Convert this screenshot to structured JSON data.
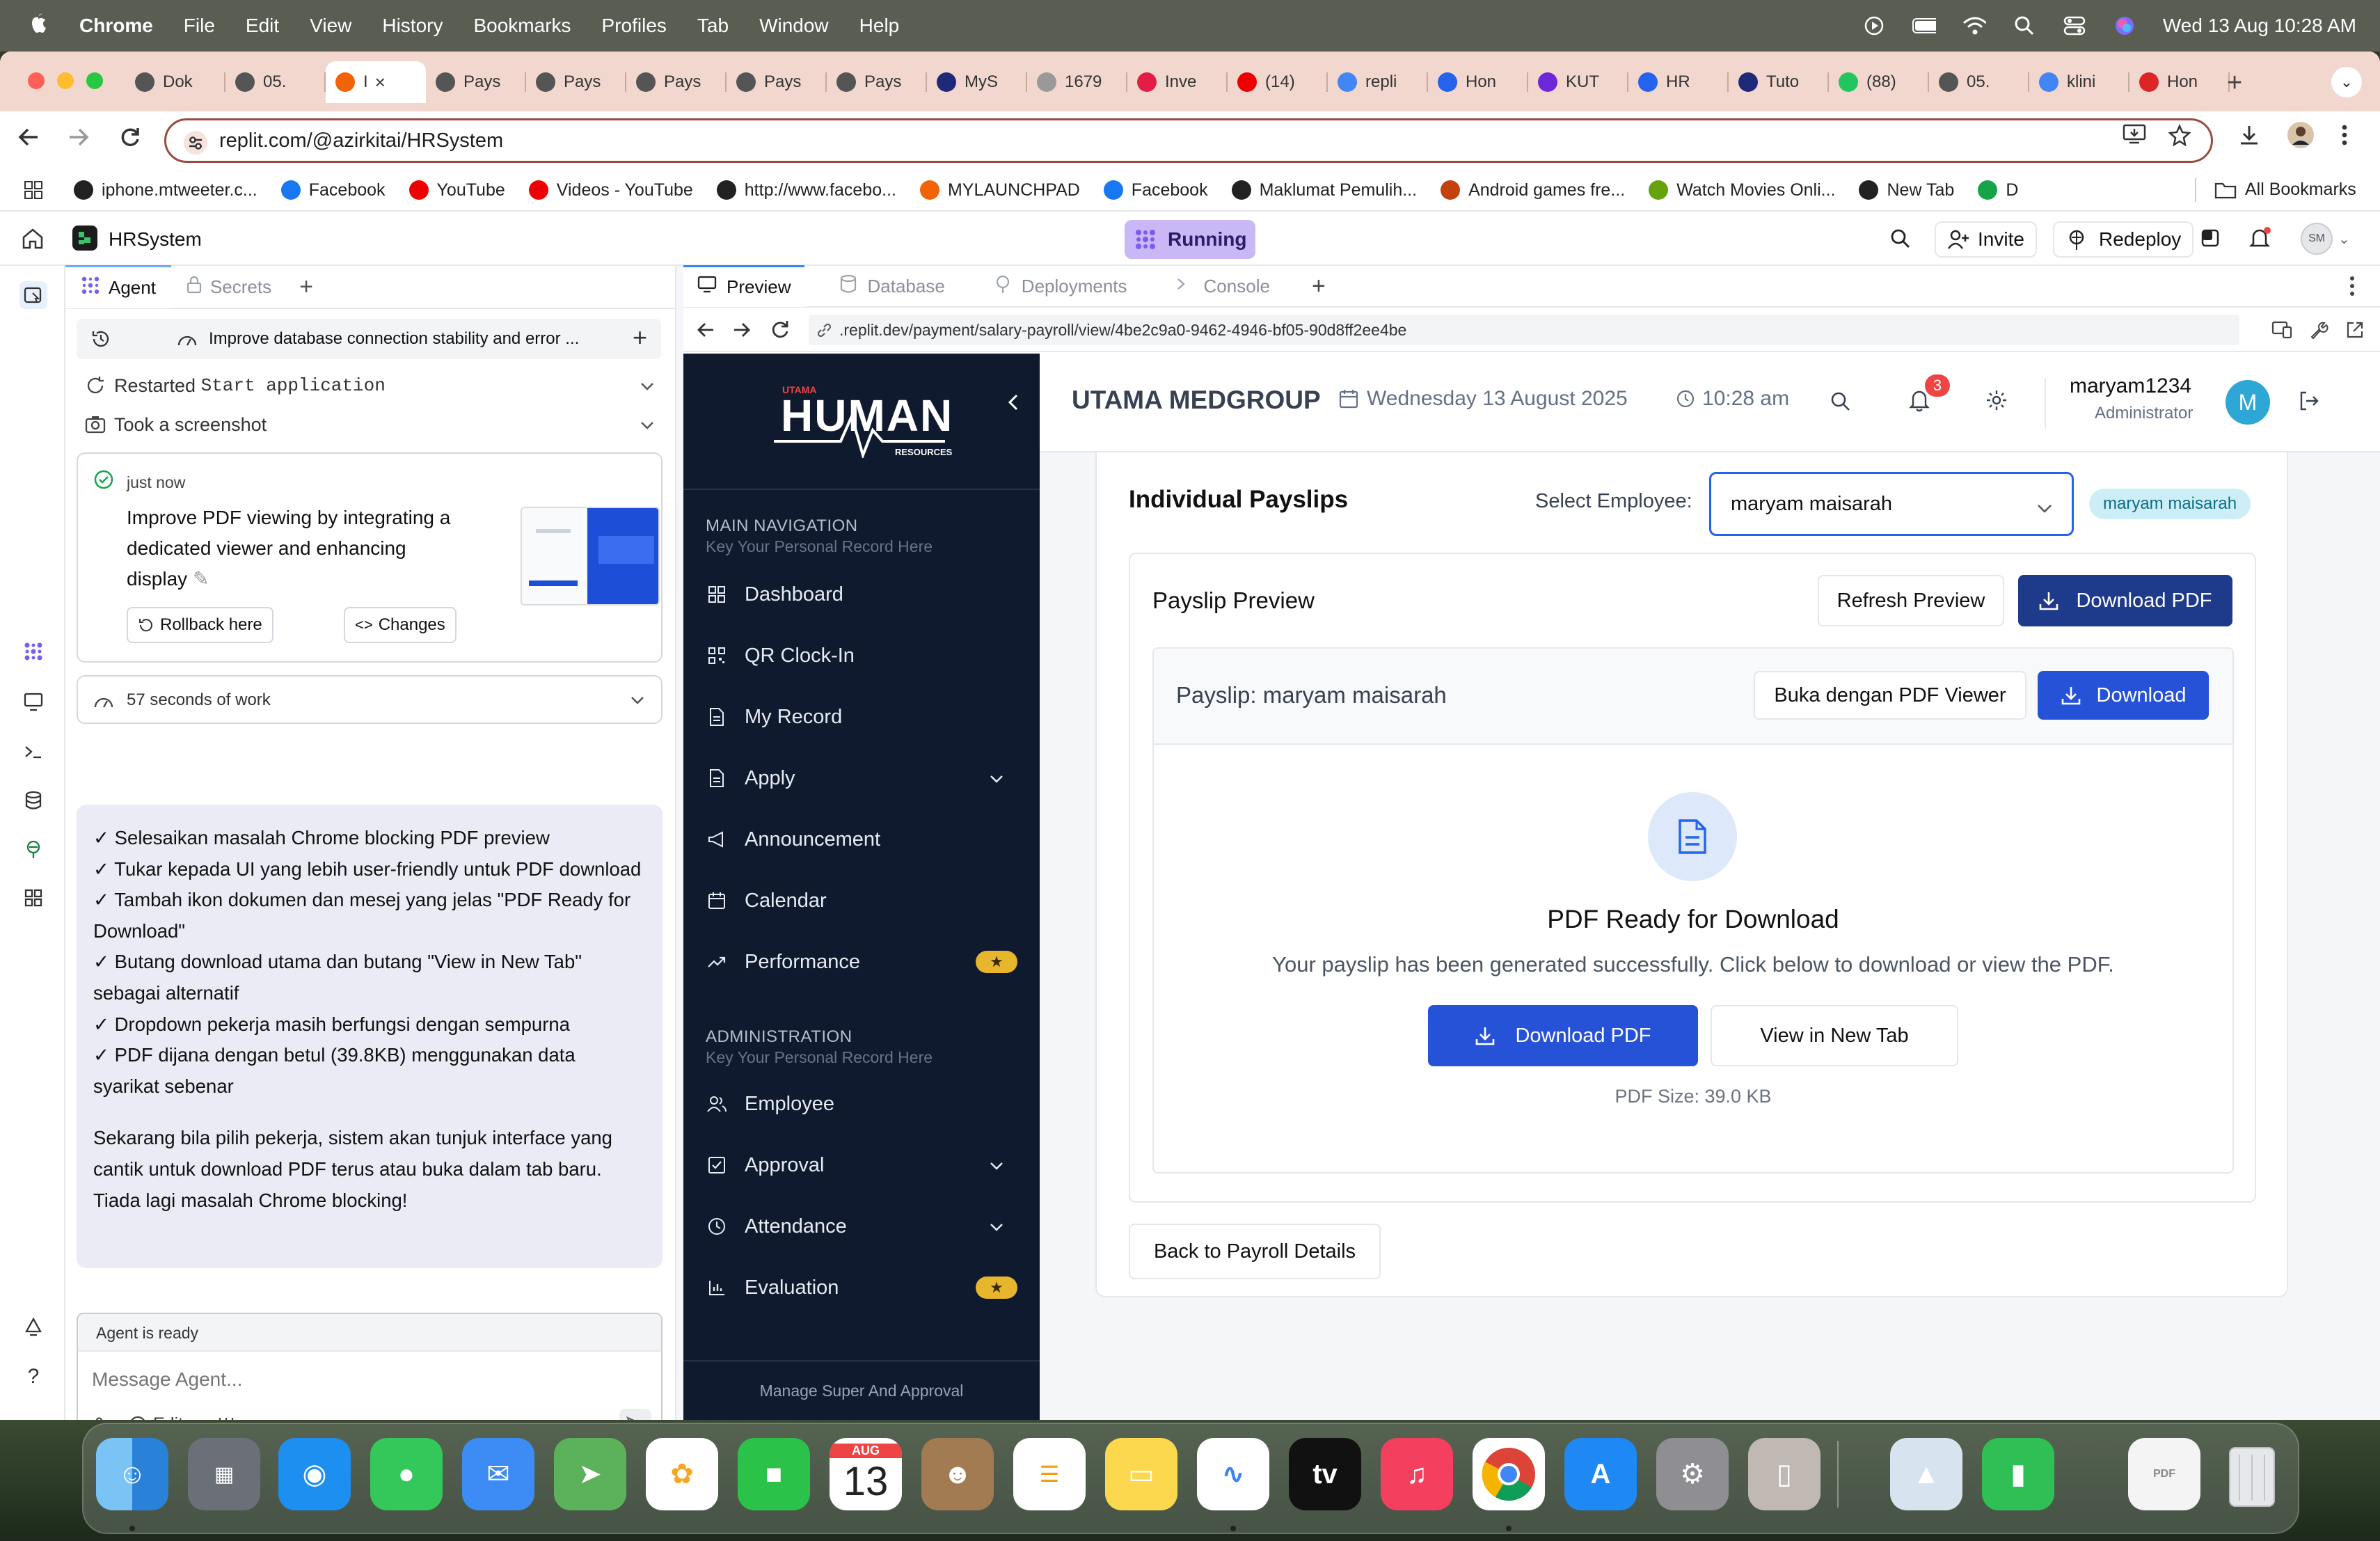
{
  "menubar": {
    "app": "Chrome",
    "items": [
      "File",
      "Edit",
      "View",
      "History",
      "Bookmarks",
      "Profiles",
      "Tab",
      "Window",
      "Help"
    ],
    "datetime": "Wed 13 Aug  10:28 AM"
  },
  "browser": {
    "tabs": [
      {
        "title": "Dok",
        "color": "#555"
      },
      {
        "title": "05.",
        "color": "#555"
      },
      {
        "title": "I",
        "color": "#f26207",
        "active": true
      },
      {
        "title": "Pays",
        "color": "#555"
      },
      {
        "title": "Pays",
        "color": "#555"
      },
      {
        "title": "Pays",
        "color": "#555"
      },
      {
        "title": "Pays",
        "color": "#555"
      },
      {
        "title": "Pays",
        "color": "#555"
      },
      {
        "title": "MyS",
        "color": "#1e2a78"
      },
      {
        "title": "1679",
        "color": "#999"
      },
      {
        "title": "Inve",
        "color": "#e11d48"
      },
      {
        "title": "(14)",
        "color": "#e00"
      },
      {
        "title": "repli",
        "color": "#4285f4"
      },
      {
        "title": "Hon",
        "color": "#2563eb"
      },
      {
        "title": "KUT",
        "color": "#6d28d9"
      },
      {
        "title": "HR",
        "color": "#2563eb"
      },
      {
        "title": "Tuto",
        "color": "#1e2a78"
      },
      {
        "title": "(88)",
        "color": "#22c55e"
      },
      {
        "title": "05.",
        "color": "#555"
      },
      {
        "title": "klini",
        "color": "#4285f4"
      },
      {
        "title": "Hon",
        "color": "#dc2626"
      }
    ],
    "url": "replit.com/@azirkitai/HRSystem",
    "bookmarks": [
      {
        "label": "iphone.mtweeter.c...",
        "color": "#222"
      },
      {
        "label": "Facebook",
        "color": "#1877f2"
      },
      {
        "label": "YouTube",
        "color": "#e00"
      },
      {
        "label": "Videos - YouTube",
        "color": "#e00"
      },
      {
        "label": "http://www.facebo...",
        "color": "#222"
      },
      {
        "label": "MYLAUNCHPAD",
        "color": "#f26207"
      },
      {
        "label": "Facebook",
        "color": "#1877f2"
      },
      {
        "label": "Maklumat Pemulih...",
        "color": "#222"
      },
      {
        "label": "Android games fre...",
        "color": "#c2410c"
      },
      {
        "label": "Watch Movies Onli...",
        "color": "#65a30d"
      },
      {
        "label": "New Tab",
        "color": "#222"
      },
      {
        "label": "D",
        "color": "#16a34a"
      }
    ],
    "all_bookmarks": "All Bookmarks"
  },
  "replit": {
    "project": "HRSystem",
    "running": "Running",
    "invite": "Invite",
    "redeploy": "Redeploy",
    "avatar": "SM",
    "left_tabs": [
      "Agent",
      "Secrets"
    ],
    "chat_title": "Improve database connection stability and error ...",
    "events": [
      {
        "label": "Restarted ",
        "code": "Start application"
      },
      {
        "label": "Took a screenshot",
        "code": ""
      }
    ],
    "checkpoint": {
      "time": "just now",
      "text": "Improve PDF viewing by integrating a dedicated viewer and enhancing display",
      "rollback": "Rollback here",
      "changes": "Changes"
    },
    "work": "57 seconds of work",
    "message_lines": [
      "✓ Selesaikan masalah Chrome blocking PDF preview",
      "✓ Tukar kepada UI yang lebih user-friendly untuk PDF download",
      "✓ Tambah ikon dokumen dan mesej yang jelas \"PDF Ready for Download\"",
      "✓ Butang download utama dan butang \"View in New Tab\" sebagai alternatif",
      "✓ Dropdown pekerja masih berfungsi dengan sempurna",
      "✓ PDF dijana dengan betul (39.8KB) menggunakan data syarikat sebenar"
    ],
    "message_summary": "Sekarang bila pilih pekerja, sistem akan tunjuk interface yang cantik untuk download PDF terus atau buka dalam tab baru. Tiada lagi masalah Chrome blocking!",
    "agent_status": "Agent is ready",
    "input_placeholder": "Message Agent...",
    "edit_label": "Edit",
    "web_tabs": [
      "Preview",
      "Database",
      "Deployments",
      "Console"
    ],
    "preview_url": ".replit.dev/payment/salary-payroll/view/4be2c9a0-9462-4946-bf05-90d8ff2ee4be"
  },
  "hr": {
    "logo_small": "UTAMA",
    "logo_main": "HUMAN",
    "logo_sub": "RESOURCES",
    "company": "UTAMA MEDGROUP",
    "date": "Wednesday 13 August 2025",
    "time": "10:28 am",
    "notif_count": "3",
    "user": "maryam1234",
    "role": "Administrator",
    "avatar_letter": "M",
    "nav_main_title": "MAIN NAVIGATION",
    "nav_main_sub": "Key Your Personal Record Here",
    "nav_main": [
      "Dashboard",
      "QR Clock-In",
      "My Record",
      "Apply",
      "Announcement",
      "Calendar",
      "Performance"
    ],
    "nav_admin_title": "ADMINISTRATION",
    "nav_admin_sub": "Key Your Personal Record Here",
    "nav_admin": [
      "Employee",
      "Approval",
      "Attendance",
      "Evaluation"
    ],
    "sidebar_footer": "Manage Super And Approval",
    "page_title": "Individual Payslips",
    "select_label": "Select Employee:",
    "selected_employee": "maryam maisarah",
    "employee_badge": "maryam maisarah",
    "preview_title": "Payslip Preview",
    "refresh_btn": "Refresh Preview",
    "download_pdf_btn": "Download PDF",
    "payslip_title": "Payslip: maryam maisarah",
    "open_viewer_btn": "Buka dengan PDF Viewer",
    "download_btn": "Download",
    "ready_title": "PDF Ready for Download",
    "ready_text": "Your payslip has been generated successfully. Click below to download or view the PDF.",
    "main_download_btn": "Download PDF",
    "new_tab_btn": "View in New Tab",
    "pdf_size": "PDF Size: 39.0 KB",
    "back_btn": "Back to Payroll Details"
  },
  "dock": {
    "calendar_month": "AUG",
    "calendar_day": "13",
    "tv_label": "tv",
    "pdf_label": "PDF"
  }
}
